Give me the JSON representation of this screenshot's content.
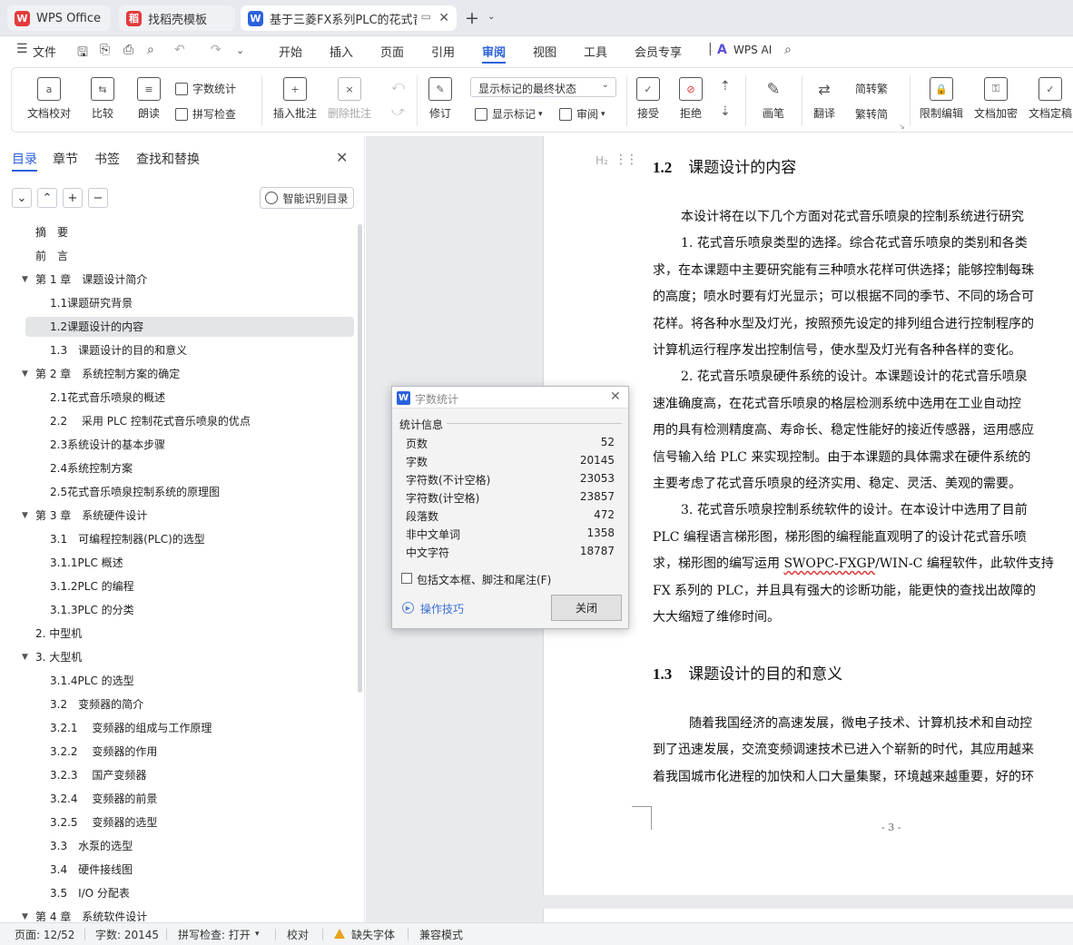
{
  "tabs": [
    {
      "label": "WPS Office",
      "icon": "wps-logo-icon",
      "color": "#e33b3b"
    },
    {
      "label": "找稻壳模板",
      "icon": "daoke-icon",
      "color": "#e33b3b"
    },
    {
      "label": "基于三菱FX系列PLC的花式音乐",
      "icon": "writer-doc-icon",
      "color": "#2a62dc",
      "active": true
    }
  ],
  "menu": {
    "file": "文件",
    "items": [
      "开始",
      "插入",
      "页面",
      "引用",
      "审阅",
      "视图",
      "工具",
      "会员专享"
    ],
    "active": "审阅",
    "wps_ai": "WPS AI"
  },
  "ribbon": {
    "doc_proof": "文档校对",
    "compare": "比较",
    "read_aloud": "朗读",
    "word_count": "字数统计",
    "spell_check": "拼写检查",
    "insert_comment": "插入批注",
    "delete_comment": "删除批注",
    "track_changes": "修订",
    "markup_state": "显示标记的最终状态",
    "show_markup": "显示标记",
    "review_pane": "审阅",
    "accept": "接受",
    "reject": "拒绝",
    "pen": "画笔",
    "translate": "翻译",
    "to_traditional": "简转繁",
    "to_simplified": "繁转简",
    "restrict_edit": "限制编辑",
    "encrypt": "文档加密",
    "finalize": "文档定稿"
  },
  "nav": {
    "tabs": [
      "目录",
      "章节",
      "书签",
      "查找和替换"
    ],
    "active_tab": "目录",
    "smart_toc": "智能识别目录",
    "toc": [
      {
        "label": "摘　要",
        "level": 1,
        "arrow": ""
      },
      {
        "label": "前　言",
        "level": 1,
        "arrow": ""
      },
      {
        "label": "第 1 章　课题设计简介",
        "level": 1,
        "arrow": "▼"
      },
      {
        "label": "1.1课题研究背景",
        "level": 2,
        "arrow": ""
      },
      {
        "label": "1.2课题设计的内容",
        "level": 2,
        "arrow": "",
        "selected": true
      },
      {
        "label": "1.3　课题设计的目的和意义",
        "level": 2,
        "arrow": ""
      },
      {
        "label": "第 2 章　系统控制方案的确定",
        "level": 1,
        "arrow": "▼"
      },
      {
        "label": "2.1花式音乐喷泉的概述",
        "level": 2,
        "arrow": ""
      },
      {
        "label": "2.2　 采用 PLC 控制花式音乐喷泉的优点",
        "level": 2,
        "arrow": ""
      },
      {
        "label": "2.3系统设计的基本步骤",
        "level": 2,
        "arrow": ""
      },
      {
        "label": "2.4系统控制方案",
        "level": 2,
        "arrow": ""
      },
      {
        "label": "2.5花式音乐喷泉控制系统的原理图",
        "level": 2,
        "arrow": ""
      },
      {
        "label": "第 3 章　系统硬件设计",
        "level": 1,
        "arrow": "▼"
      },
      {
        "label": "3.1　可编程控制器(PLC)的选型",
        "level": 2,
        "arrow": ""
      },
      {
        "label": "3.1.1PLC 概述",
        "level": 2,
        "arrow": ""
      },
      {
        "label": "3.1.2PLC 的编程",
        "level": 2,
        "arrow": ""
      },
      {
        "label": "3.1.3PLC 的分类",
        "level": 2,
        "arrow": ""
      },
      {
        "label": "2. 中型机",
        "level": 1,
        "arrow": ""
      },
      {
        "label": "3. 大型机",
        "level": 1,
        "arrow": "▼"
      },
      {
        "label": "3.1.4PLC 的选型",
        "level": 2,
        "arrow": ""
      },
      {
        "label": "3.2　变频器的简介",
        "level": 2,
        "arrow": ""
      },
      {
        "label": "3.2.1　 变频器的组成与工作原理",
        "level": 2,
        "arrow": ""
      },
      {
        "label": "3.2.2　 变频器的作用",
        "level": 2,
        "arrow": ""
      },
      {
        "label": "3.2.3　 国产变频器",
        "level": 2,
        "arrow": ""
      },
      {
        "label": "3.2.4　 变频器的前景",
        "level": 2,
        "arrow": ""
      },
      {
        "label": "3.2.5　 变频器的选型",
        "level": 2,
        "arrow": ""
      },
      {
        "label": "3.3　水泵的选型",
        "level": 2,
        "arrow": ""
      },
      {
        "label": "3.4　硬件接线图",
        "level": 2,
        "arrow": ""
      },
      {
        "label": "3.5　I/O 分配表",
        "level": 2,
        "arrow": ""
      },
      {
        "label": "第 4 章　系统软件设计",
        "level": 1,
        "arrow": "▼"
      }
    ]
  },
  "document": {
    "heading_mark": "H₂",
    "h12_num": "1.2",
    "h12_text": "课题设计的内容",
    "h13_num": "1.3",
    "h13_text": "课题设计的目的和意义",
    "lines": [
      "本设计将在以下几个方面对花式音乐喷泉的控制系统进行研究",
      "1.  花式音乐喷泉类型的选择。综合花式音乐喷泉的类别和各类",
      "求，在本课题中主要研究能有三种喷水花样可供选择；能够控制每珠",
      "的高度；喷水时要有灯光显示；可以根据不同的季节、不同的场合可",
      "花样。将各种水型及灯光，按照预先设定的排列组合进行控制程序的",
      "计算机运行程序发出控制信号，使水型及灯光有各种各样的变化。",
      "2.  花式音乐喷泉硬件系统的设计。本课题设计的花式音乐喷泉",
      "速准确度高，在花式音乐喷泉的格层检测系统中选用在工业自动控",
      "用的具有检测精度高、寿命长、稳定性能好的接近传感器，运用感应",
      "信号输入给 PLC 来实现控制。由于本课题的具体需求在硬件系统的",
      "主要考虑了花式音乐喷泉的经济实用、稳定、灵活、美观的需要。",
      "3.  花式音乐喷泉控制系统软件的设计。在本设计中选用了目前",
      "PLC 编程语言梯形图，梯形图的编程能直观明了的设计花式音乐喷"
    ],
    "line_sw_pre": "求，梯形图的编写运用 ",
    "line_sw_err": "SWOPC-FXGP",
    "line_sw_post": "/WIN-C 编程软件，此软件支持",
    "lines2": [
      "FX 系列的 PLC，并且具有强大的诊断功能，能更快的查找出故障的",
      "大大缩短了维修时间。"
    ],
    "lines3": [
      "随着我国经济的高速发展，微电子技术、计算机技术和自动控",
      "到了迅速发展，交流变频调速技术已进入个崭新的时代，其应用越来",
      "着我国城市化进程的加快和人口大量集聚，环境越来越重要，好的环"
    ],
    "page_number": "- 3 -"
  },
  "word_count_dialog": {
    "title": "字数统计",
    "section": "统计信息",
    "rows": [
      {
        "k": "页数",
        "v": "52"
      },
      {
        "k": "字数",
        "v": "20145"
      },
      {
        "k": "字符数(不计空格)",
        "v": "23053"
      },
      {
        "k": "字符数(计空格)",
        "v": "23857"
      },
      {
        "k": "段落数",
        "v": "472"
      },
      {
        "k": "非中文单词",
        "v": "1358"
      },
      {
        "k": "中文字符",
        "v": "18787"
      }
    ],
    "include_label": "包括文本框、脚注和尾注(F)",
    "tips": "操作技巧",
    "close": "关闭"
  },
  "status": {
    "page": "页面: 12/52",
    "words": "字数: 20145",
    "spell": "拼写检查: 打开",
    "proof": "校对",
    "missing_font": "缺失字体",
    "compat": "兼容模式"
  }
}
